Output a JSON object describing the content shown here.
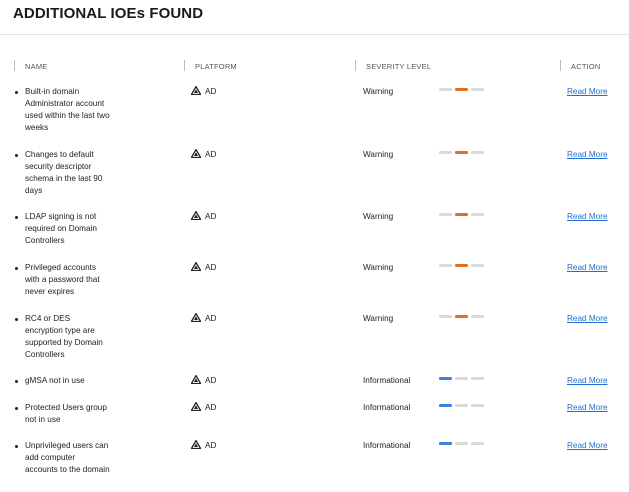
{
  "page": {
    "title": "ADDITIONAL IOEs FOUND"
  },
  "colors": {
    "warning": "#e0701f",
    "informational": "#3d7fe0",
    "inactive": "#d9d9d9",
    "link": "#1f6fd1"
  },
  "columns": {
    "name": "NAME",
    "platform": "PLATFORM",
    "severity": "SEVERITY LEVEL",
    "action": "ACTION"
  },
  "rows": [
    {
      "name": "Built-in domain Administrator account used within the last two weeks",
      "platform": "AD",
      "severity": "Warning",
      "action": "Read More"
    },
    {
      "name": "Changes to default security descriptor schema in the last 90 days",
      "platform": "AD",
      "severity": "Warning",
      "action": "Read More"
    },
    {
      "name": "LDAP signing is not required on Domain Controllers",
      "platform": "AD",
      "severity": "Warning",
      "action": "Read More"
    },
    {
      "name": "Privileged accounts with a password that never expires",
      "platform": "AD",
      "severity": "Warning",
      "action": "Read More"
    },
    {
      "name": "RC4 or DES encryption type are supported by Domain Controllers",
      "platform": "AD",
      "severity": "Warning",
      "action": "Read More"
    },
    {
      "name": "gMSA not in use",
      "platform": "AD",
      "severity": "Informational",
      "action": "Read More"
    },
    {
      "name": "Protected Users group not in use",
      "platform": "AD",
      "severity": "Informational",
      "action": "Read More"
    },
    {
      "name": "Unprivileged users can add computer accounts to the domain",
      "platform": "AD",
      "severity": "Informational",
      "action": "Read More"
    }
  ]
}
